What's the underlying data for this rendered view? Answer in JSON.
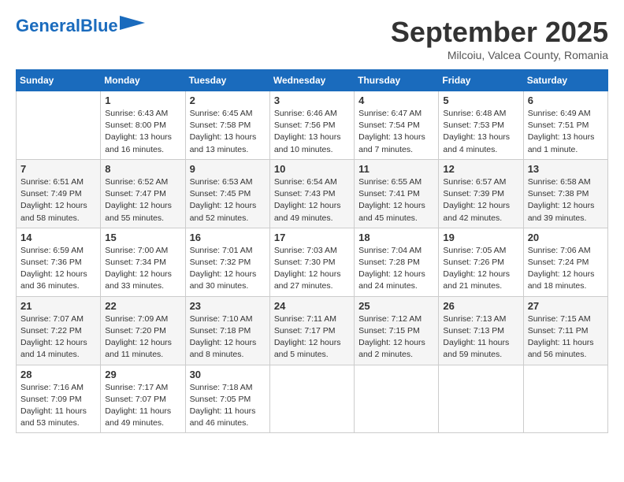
{
  "logo": {
    "line1": "General",
    "line2": "Blue"
  },
  "title": "September 2025",
  "subtitle": "Milcoiu, Valcea County, Romania",
  "days_header": [
    "Sunday",
    "Monday",
    "Tuesday",
    "Wednesday",
    "Thursday",
    "Friday",
    "Saturday"
  ],
  "weeks": [
    [
      {
        "num": "",
        "info": ""
      },
      {
        "num": "1",
        "info": "Sunrise: 6:43 AM\nSunset: 8:00 PM\nDaylight: 13 hours\nand 16 minutes."
      },
      {
        "num": "2",
        "info": "Sunrise: 6:45 AM\nSunset: 7:58 PM\nDaylight: 13 hours\nand 13 minutes."
      },
      {
        "num": "3",
        "info": "Sunrise: 6:46 AM\nSunset: 7:56 PM\nDaylight: 13 hours\nand 10 minutes."
      },
      {
        "num": "4",
        "info": "Sunrise: 6:47 AM\nSunset: 7:54 PM\nDaylight: 13 hours\nand 7 minutes."
      },
      {
        "num": "5",
        "info": "Sunrise: 6:48 AM\nSunset: 7:53 PM\nDaylight: 13 hours\nand 4 minutes."
      },
      {
        "num": "6",
        "info": "Sunrise: 6:49 AM\nSunset: 7:51 PM\nDaylight: 13 hours\nand 1 minute."
      }
    ],
    [
      {
        "num": "7",
        "info": "Sunrise: 6:51 AM\nSunset: 7:49 PM\nDaylight: 12 hours\nand 58 minutes."
      },
      {
        "num": "8",
        "info": "Sunrise: 6:52 AM\nSunset: 7:47 PM\nDaylight: 12 hours\nand 55 minutes."
      },
      {
        "num": "9",
        "info": "Sunrise: 6:53 AM\nSunset: 7:45 PM\nDaylight: 12 hours\nand 52 minutes."
      },
      {
        "num": "10",
        "info": "Sunrise: 6:54 AM\nSunset: 7:43 PM\nDaylight: 12 hours\nand 49 minutes."
      },
      {
        "num": "11",
        "info": "Sunrise: 6:55 AM\nSunset: 7:41 PM\nDaylight: 12 hours\nand 45 minutes."
      },
      {
        "num": "12",
        "info": "Sunrise: 6:57 AM\nSunset: 7:39 PM\nDaylight: 12 hours\nand 42 minutes."
      },
      {
        "num": "13",
        "info": "Sunrise: 6:58 AM\nSunset: 7:38 PM\nDaylight: 12 hours\nand 39 minutes."
      }
    ],
    [
      {
        "num": "14",
        "info": "Sunrise: 6:59 AM\nSunset: 7:36 PM\nDaylight: 12 hours\nand 36 minutes."
      },
      {
        "num": "15",
        "info": "Sunrise: 7:00 AM\nSunset: 7:34 PM\nDaylight: 12 hours\nand 33 minutes."
      },
      {
        "num": "16",
        "info": "Sunrise: 7:01 AM\nSunset: 7:32 PM\nDaylight: 12 hours\nand 30 minutes."
      },
      {
        "num": "17",
        "info": "Sunrise: 7:03 AM\nSunset: 7:30 PM\nDaylight: 12 hours\nand 27 minutes."
      },
      {
        "num": "18",
        "info": "Sunrise: 7:04 AM\nSunset: 7:28 PM\nDaylight: 12 hours\nand 24 minutes."
      },
      {
        "num": "19",
        "info": "Sunrise: 7:05 AM\nSunset: 7:26 PM\nDaylight: 12 hours\nand 21 minutes."
      },
      {
        "num": "20",
        "info": "Sunrise: 7:06 AM\nSunset: 7:24 PM\nDaylight: 12 hours\nand 18 minutes."
      }
    ],
    [
      {
        "num": "21",
        "info": "Sunrise: 7:07 AM\nSunset: 7:22 PM\nDaylight: 12 hours\nand 14 minutes."
      },
      {
        "num": "22",
        "info": "Sunrise: 7:09 AM\nSunset: 7:20 PM\nDaylight: 12 hours\nand 11 minutes."
      },
      {
        "num": "23",
        "info": "Sunrise: 7:10 AM\nSunset: 7:18 PM\nDaylight: 12 hours\nand 8 minutes."
      },
      {
        "num": "24",
        "info": "Sunrise: 7:11 AM\nSunset: 7:17 PM\nDaylight: 12 hours\nand 5 minutes."
      },
      {
        "num": "25",
        "info": "Sunrise: 7:12 AM\nSunset: 7:15 PM\nDaylight: 12 hours\nand 2 minutes."
      },
      {
        "num": "26",
        "info": "Sunrise: 7:13 AM\nSunset: 7:13 PM\nDaylight: 11 hours\nand 59 minutes."
      },
      {
        "num": "27",
        "info": "Sunrise: 7:15 AM\nSunset: 7:11 PM\nDaylight: 11 hours\nand 56 minutes."
      }
    ],
    [
      {
        "num": "28",
        "info": "Sunrise: 7:16 AM\nSunset: 7:09 PM\nDaylight: 11 hours\nand 53 minutes."
      },
      {
        "num": "29",
        "info": "Sunrise: 7:17 AM\nSunset: 7:07 PM\nDaylight: 11 hours\nand 49 minutes."
      },
      {
        "num": "30",
        "info": "Sunrise: 7:18 AM\nSunset: 7:05 PM\nDaylight: 11 hours\nand 46 minutes."
      },
      {
        "num": "",
        "info": ""
      },
      {
        "num": "",
        "info": ""
      },
      {
        "num": "",
        "info": ""
      },
      {
        "num": "",
        "info": ""
      }
    ]
  ]
}
